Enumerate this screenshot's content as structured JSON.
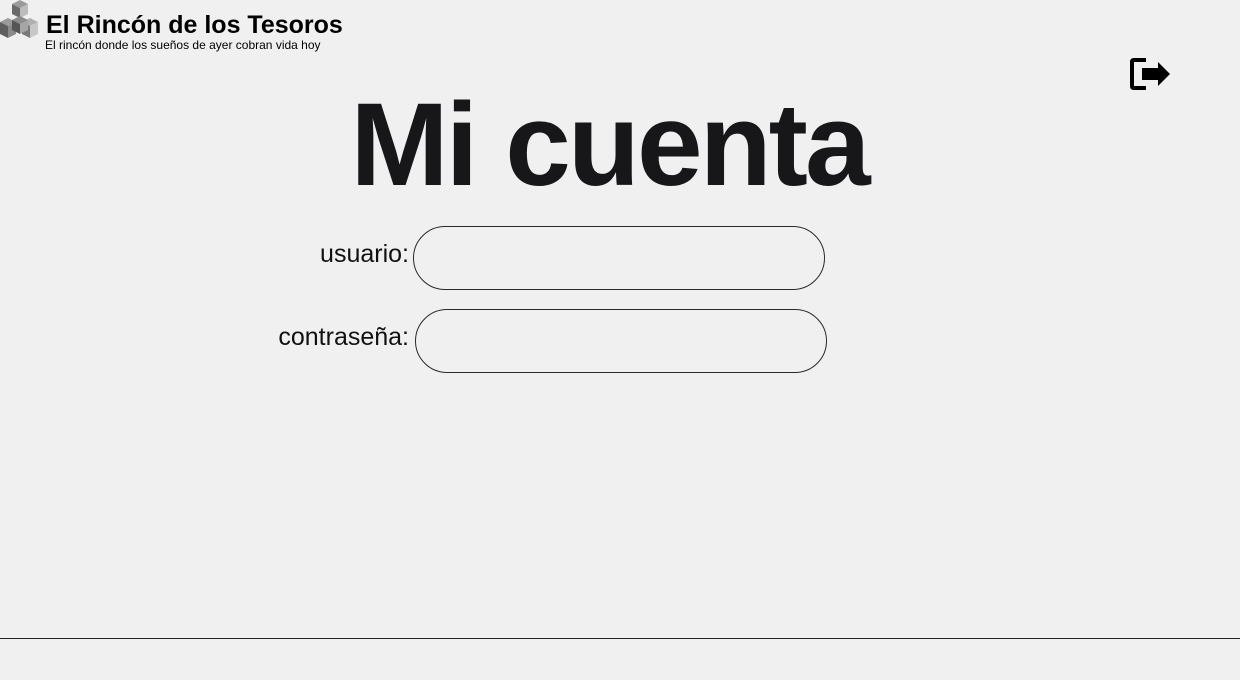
{
  "header": {
    "brand_name": "El Rincón de los Tesoros",
    "tagline": "El rincón donde los sueños de ayer cobran vida hoy",
    "logo_icon": "cubes-logo-icon",
    "logout_icon": "sign-out-icon"
  },
  "main": {
    "title": "Mi cuenta",
    "form": {
      "username_label": "usuario:",
      "username_value": "",
      "password_label": "contraseña:",
      "password_value": ""
    }
  },
  "colors": {
    "background": "#f0f0f0",
    "title": "#17171a",
    "border": "#2a2a2a"
  }
}
